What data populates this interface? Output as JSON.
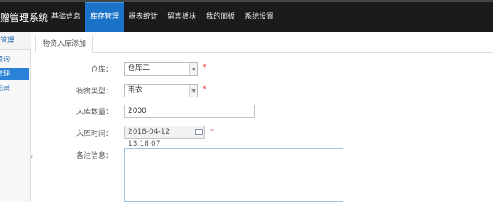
{
  "app": {
    "title": "捐赠管理系统"
  },
  "nav": {
    "items": [
      "基础信息",
      "库存管理",
      "报表统计",
      "留言板块",
      "我的面板",
      "系统设置"
    ],
    "active_index": 1
  },
  "sidebar": {
    "header": "存管理",
    "items": [
      "查询",
      "管理",
      "记录"
    ],
    "active_index": 1
  },
  "tabs": [
    {
      "label": "物资入库添加"
    }
  ],
  "form": {
    "warehouse": {
      "label": "仓库：",
      "value": "仓库二",
      "required": "*"
    },
    "type": {
      "label": "物资类型：",
      "value": "雨衣",
      "required": "*"
    },
    "quantity": {
      "label": "入库数量：",
      "value": "2000"
    },
    "time": {
      "label": "入库时间：",
      "value": "2018-04-12 13:18:07",
      "required": "*"
    },
    "remark": {
      "label": "备注信息：",
      "value": ""
    }
  },
  "colors": {
    "accent": "#1a73c8",
    "topbar": "#1b1b1b",
    "required": "#e22233"
  }
}
